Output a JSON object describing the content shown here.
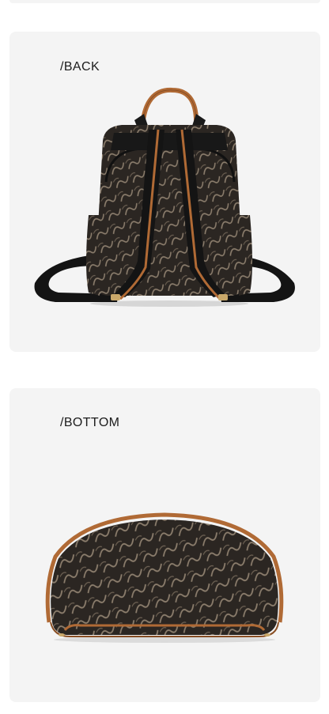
{
  "views": [
    {
      "label": "/BACK"
    },
    {
      "label": "/BOTTOM"
    }
  ],
  "colors": {
    "panel_background": "#f4f4f4",
    "bag_dark": "#2b2622",
    "pattern_light": "#8c7e6d",
    "trim_tan": "#b06a35",
    "strap_black": "#141414"
  }
}
